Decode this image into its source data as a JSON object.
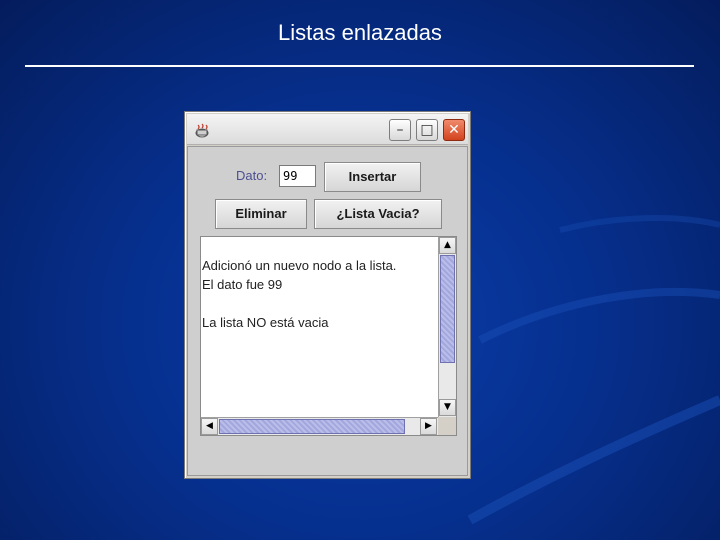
{
  "slide": {
    "title": "Listas enlazadas"
  },
  "window": {
    "controls": {
      "minimize": "–",
      "maximize": "□",
      "close": "✕"
    },
    "form": {
      "dato_label": "Dato:",
      "dato_value": "99",
      "insertar_label": "Insertar",
      "eliminar_label": "Eliminar",
      "lista_vacia_label": "¿Lista Vacia?"
    },
    "output": {
      "lines": [
        "Adicionó un nuevo nodo a la lista.",
        "El dato fue 99",
        "",
        "La lista NO está vacia"
      ]
    },
    "scroll": {
      "up": "▲",
      "down": "▼",
      "left": "◀",
      "right": "▶"
    }
  },
  "colors": {
    "background": "#06308f",
    "label": "#4c4f90",
    "scroll_thumb": "#a2a7de"
  }
}
